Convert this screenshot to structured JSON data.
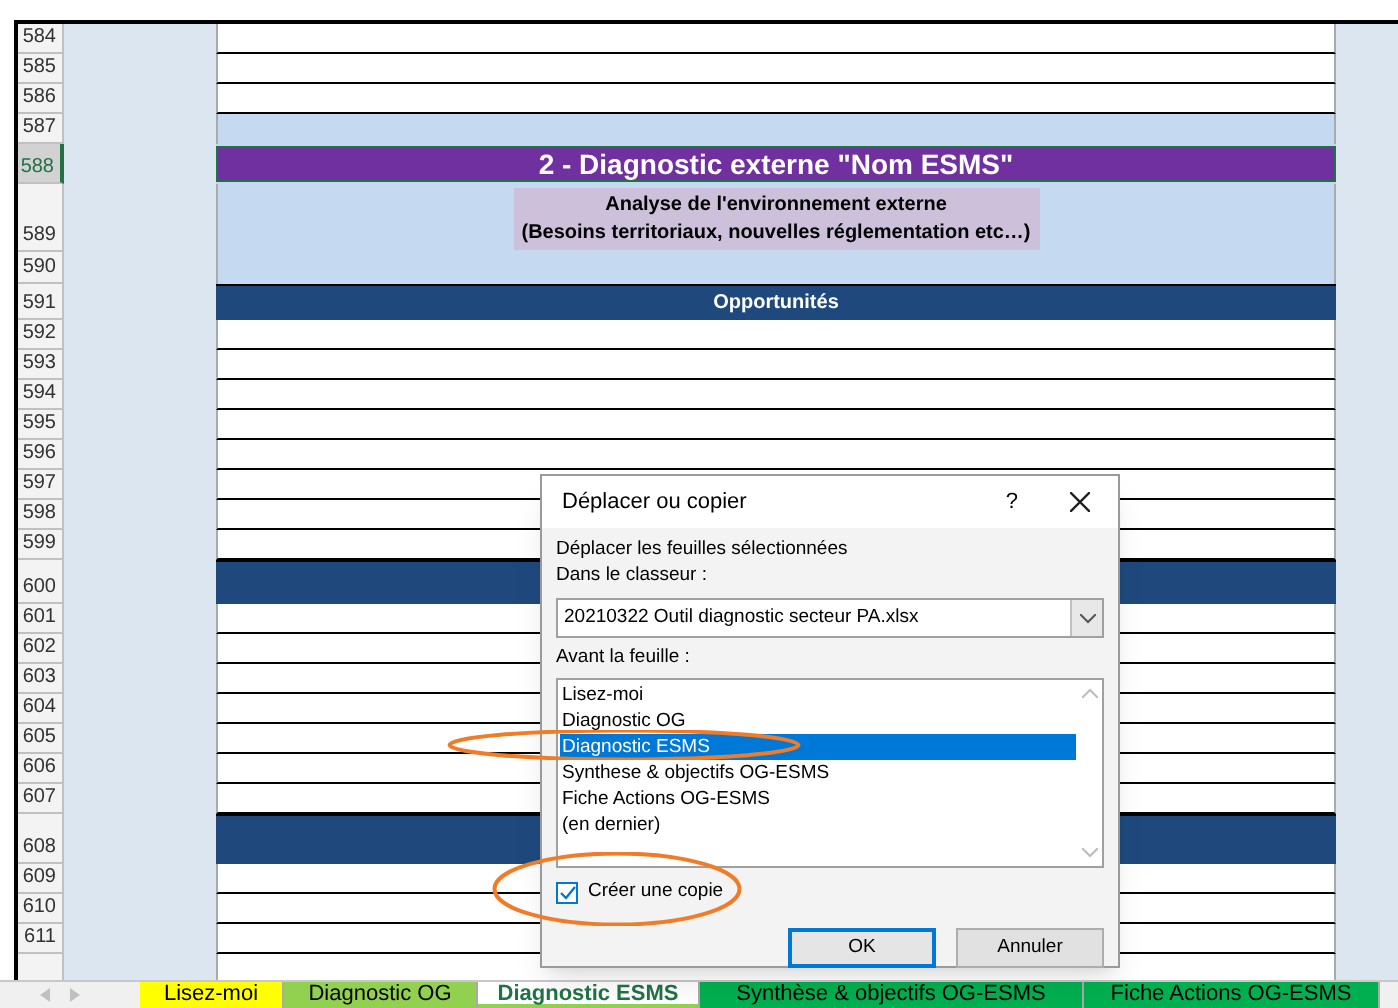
{
  "rows": [
    {
      "number": "584",
      "kind": "blank",
      "selected": false
    },
    {
      "number": "585",
      "kind": "blank",
      "selected": false
    },
    {
      "number": "586",
      "kind": "blank",
      "selected": false
    },
    {
      "number": "587",
      "kind": "band",
      "selected": false
    },
    {
      "number": "588",
      "kind": "title",
      "selected": true,
      "text": "2 - Diagnostic externe \"Nom ESMS\""
    },
    {
      "number": "589",
      "kind": "subtitle",
      "selected": false,
      "lines": [
        "Analyse de l'environnement externe",
        "(Besoins territoriaux, nouvelles réglementation etc…)"
      ]
    },
    {
      "number": "590",
      "kind": "band",
      "selected": false
    },
    {
      "number": "591",
      "kind": "header",
      "selected": false,
      "text": "Opportunités"
    },
    {
      "number": "592",
      "kind": "blank",
      "selected": false
    },
    {
      "number": "593",
      "kind": "blank",
      "selected": false
    },
    {
      "number": "594",
      "kind": "blank",
      "selected": false
    },
    {
      "number": "595",
      "kind": "blank",
      "selected": false
    },
    {
      "number": "596",
      "kind": "blank",
      "selected": false
    },
    {
      "number": "597",
      "kind": "blank",
      "selected": false
    },
    {
      "number": "598",
      "kind": "blank",
      "selected": false
    },
    {
      "number": "599",
      "kind": "blank",
      "selected": false
    },
    {
      "number": "600",
      "kind": "header",
      "selected": false
    },
    {
      "number": "601",
      "kind": "blank",
      "selected": false
    },
    {
      "number": "602",
      "kind": "blank",
      "selected": false
    },
    {
      "number": "603",
      "kind": "blank",
      "selected": false
    },
    {
      "number": "604",
      "kind": "blank",
      "selected": false
    },
    {
      "number": "605",
      "kind": "blank",
      "selected": false
    },
    {
      "number": "606",
      "kind": "blank",
      "selected": false
    },
    {
      "number": "607",
      "kind": "blank",
      "selected": false
    },
    {
      "number": "608",
      "kind": "header",
      "selected": false
    },
    {
      "number": "609",
      "kind": "blank",
      "selected": false
    },
    {
      "number": "610",
      "kind": "blank",
      "selected": false
    },
    {
      "number": "611",
      "kind": "blank",
      "selected": false
    }
  ],
  "dialog": {
    "title": "Déplacer ou copier",
    "help": "?",
    "move_label": "Déplacer les feuilles sélectionnées",
    "workbook_label": "Dans le classeur :",
    "workbook_select": {
      "value": "20210322 Outil diagnostic secteur PA.xlsx"
    },
    "sheet_label": "Avant la feuille :",
    "sheets": [
      {
        "label": "Lisez-moi",
        "selected": false,
        "circled": false
      },
      {
        "label": "Diagnostic OG",
        "selected": false,
        "circled": false
      },
      {
        "label": "Diagnostic ESMS",
        "selected": true,
        "circled": true
      },
      {
        "label": "Synthese & objectifs OG-ESMS",
        "selected": false,
        "circled": false
      },
      {
        "label": "Fiche Actions OG-ESMS",
        "selected": false,
        "circled": false
      },
      {
        "label": "(en dernier)",
        "selected": false,
        "circled": false
      }
    ],
    "copy_checkbox": {
      "label": "Créer une copie",
      "checked": true,
      "circled": true
    },
    "buttons": [
      {
        "label": "OK",
        "default": true
      },
      {
        "label": "Annuler",
        "default": false
      }
    ]
  },
  "sheet_tabs": [
    {
      "label": "Lisez-moi",
      "color": "#ffff00",
      "selected": false
    },
    {
      "label": "Diagnostic OG",
      "color": "#92d050",
      "selected": false
    },
    {
      "label": "Diagnostic ESMS",
      "color": "#92d050",
      "selected": true
    },
    {
      "label": "Synthèse & objectifs OG-ESMS",
      "color": "#00b050",
      "selected": false
    },
    {
      "label": "Fiche Actions OG-ESMS",
      "color": "#00b050",
      "selected": false
    }
  ]
}
